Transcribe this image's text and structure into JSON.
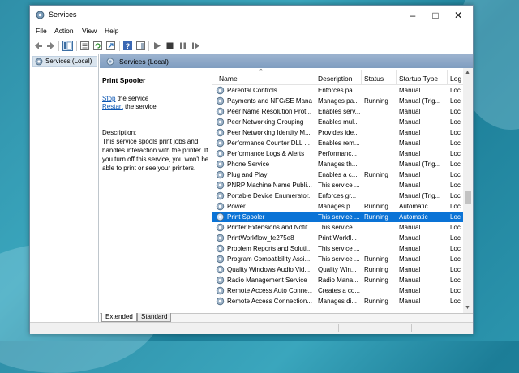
{
  "window": {
    "title": "Services"
  },
  "menu": [
    "File",
    "Action",
    "View",
    "Help"
  ],
  "tree": {
    "root_label": "Services (Local)"
  },
  "panel": {
    "header": "Services (Local)"
  },
  "selected_service": {
    "name": "Print Spooler",
    "stop_link": "Stop",
    "stop_suffix": " the service",
    "restart_link": "Restart",
    "restart_suffix": " the service",
    "description_label": "Description:",
    "description": "This service spools print jobs and handles interaction with the printer. If you turn off this service, you won't be able to print or see your printers."
  },
  "columns": {
    "name": "Name",
    "description": "Description",
    "status": "Status",
    "startup": "Startup Type",
    "log_on": "Log"
  },
  "services": [
    {
      "name": "Parental Controls",
      "description": "Enforces pa...",
      "status": "",
      "startup": "Manual",
      "log_on": "Loc"
    },
    {
      "name": "Payments and NFC/SE Mana...",
      "description": "Manages pa...",
      "status": "Running",
      "startup": "Manual (Trig...",
      "log_on": "Loc"
    },
    {
      "name": "Peer Name Resolution Prot...",
      "description": "Enables serv...",
      "status": "",
      "startup": "Manual",
      "log_on": "Loc"
    },
    {
      "name": "Peer Networking Grouping",
      "description": "Enables mul...",
      "status": "",
      "startup": "Manual",
      "log_on": "Loc"
    },
    {
      "name": "Peer Networking Identity M...",
      "description": "Provides ide...",
      "status": "",
      "startup": "Manual",
      "log_on": "Loc"
    },
    {
      "name": "Performance Counter DLL ...",
      "description": "Enables rem...",
      "status": "",
      "startup": "Manual",
      "log_on": "Loc"
    },
    {
      "name": "Performance Logs & Alerts",
      "description": "Performanc...",
      "status": "",
      "startup": "Manual",
      "log_on": "Loc"
    },
    {
      "name": "Phone Service",
      "description": "Manages th...",
      "status": "",
      "startup": "Manual (Trig...",
      "log_on": "Loc"
    },
    {
      "name": "Plug and Play",
      "description": "Enables a c...",
      "status": "Running",
      "startup": "Manual",
      "log_on": "Loc"
    },
    {
      "name": "PNRP Machine Name Publi...",
      "description": "This service ...",
      "status": "",
      "startup": "Manual",
      "log_on": "Loc"
    },
    {
      "name": "Portable Device Enumerator...",
      "description": "Enforces gr...",
      "status": "",
      "startup": "Manual (Trig...",
      "log_on": "Loc"
    },
    {
      "name": "Power",
      "description": "Manages p...",
      "status": "Running",
      "startup": "Automatic",
      "log_on": "Loc"
    },
    {
      "name": "Print Spooler",
      "description": "This service ...",
      "status": "Running",
      "startup": "Automatic",
      "log_on": "Loc",
      "selected": true
    },
    {
      "name": "Printer Extensions and Notif...",
      "description": "This service ...",
      "status": "",
      "startup": "Manual",
      "log_on": "Loc"
    },
    {
      "name": "PrintWorkflow_fe275e8",
      "description": "Print Workfl...",
      "status": "",
      "startup": "Manual",
      "log_on": "Loc"
    },
    {
      "name": "Problem Reports and Soluti...",
      "description": "This service ...",
      "status": "",
      "startup": "Manual",
      "log_on": "Loc"
    },
    {
      "name": "Program Compatibility Assi...",
      "description": "This service ...",
      "status": "Running",
      "startup": "Manual",
      "log_on": "Loc"
    },
    {
      "name": "Quality Windows Audio Vid...",
      "description": "Quality Win...",
      "status": "Running",
      "startup": "Manual",
      "log_on": "Loc"
    },
    {
      "name": "Radio Management Service",
      "description": "Radio Mana...",
      "status": "Running",
      "startup": "Manual",
      "log_on": "Loc"
    },
    {
      "name": "Remote Access Auto Conne...",
      "description": "Creates a co...",
      "status": "",
      "startup": "Manual",
      "log_on": "Loc"
    },
    {
      "name": "Remote Access Connection...",
      "description": "Manages di...",
      "status": "Running",
      "startup": "Manual",
      "log_on": "Loc"
    }
  ],
  "tabs": [
    "Extended",
    "Standard"
  ],
  "colors": {
    "selection": "#0a73d6",
    "panel_header": "#8fa9c8",
    "link": "#0b56b3"
  },
  "icons": [
    "back-icon",
    "forward-icon",
    "console-tree-icon",
    "properties-icon",
    "refresh-icon",
    "export-icon",
    "help-icon",
    "show-hide-icon",
    "start-icon",
    "stop-icon",
    "pause-icon",
    "restart-icon",
    "gear-icon"
  ]
}
